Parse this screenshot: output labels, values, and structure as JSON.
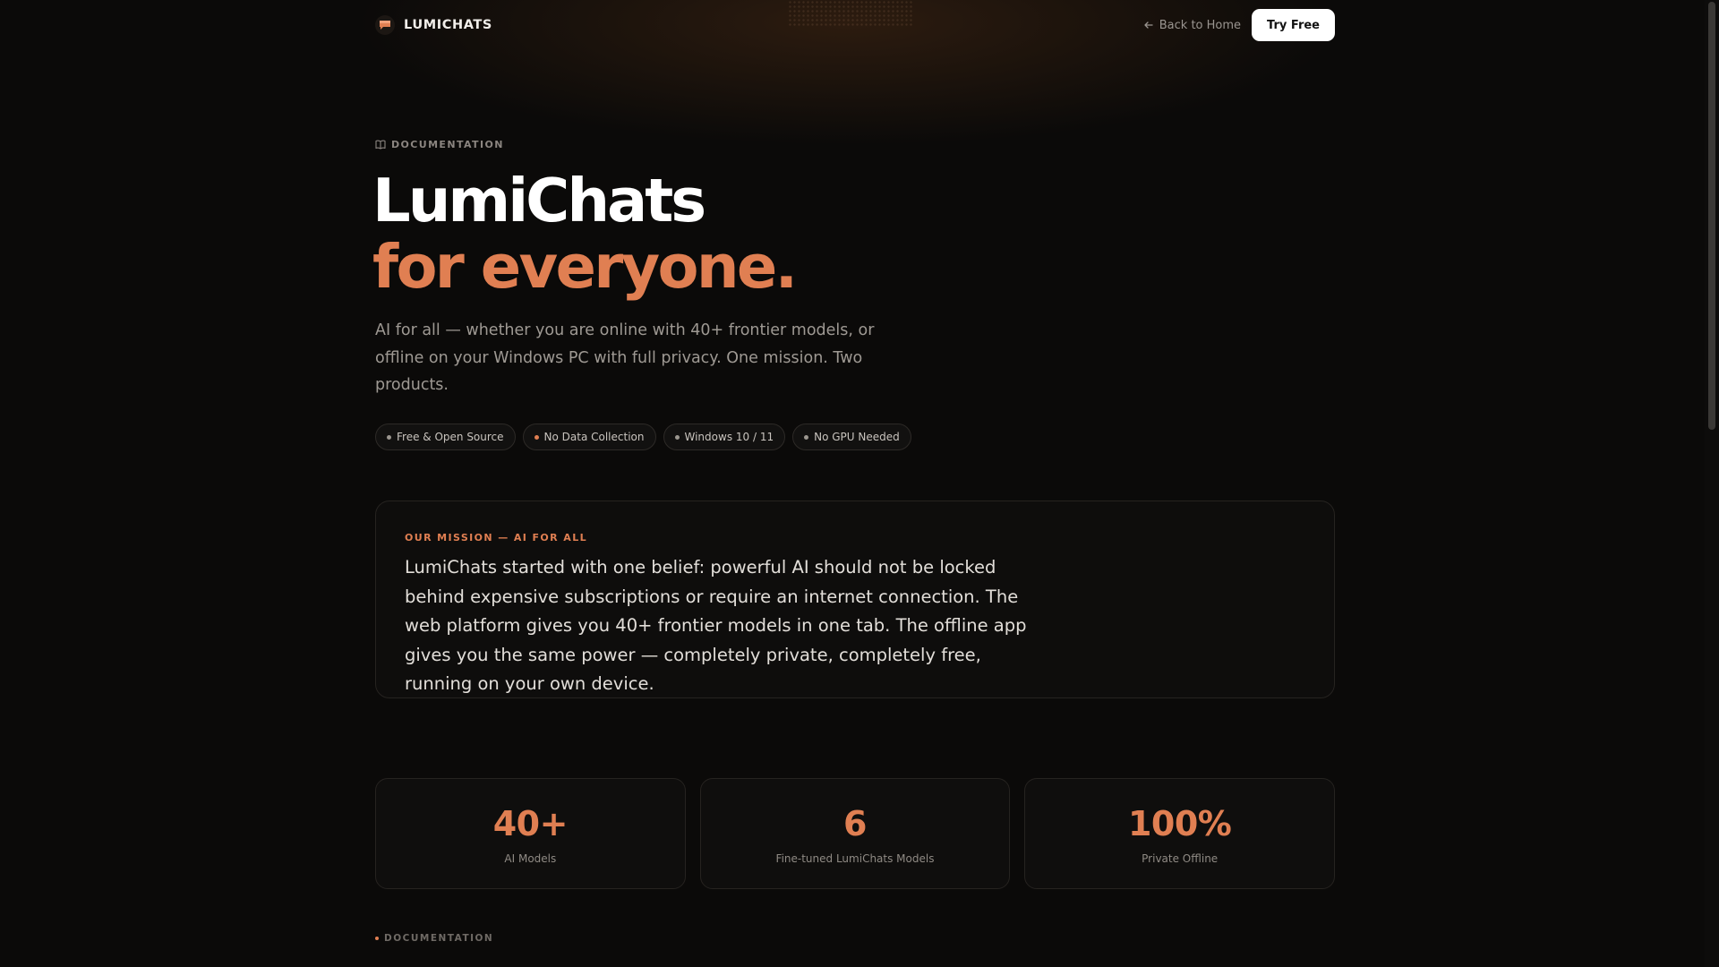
{
  "header": {
    "brand": "LUMICHATS",
    "logo_icon": "chat-bubble-icon",
    "back_label": "Back to Home",
    "cta_label": "Try Free"
  },
  "hero": {
    "eyebrow": "DOCUMENTATION",
    "title_line1": "LumiChats",
    "title_line2": "for everyone.",
    "lede": "AI for all — whether you are online with 40+ frontier models, or offline on your Windows PC with full privacy. One mission. Two products.",
    "pills": [
      {
        "label": "Free & Open Source",
        "dot": "#9b968f"
      },
      {
        "label": "No Data Collection",
        "dot": "#e07f52"
      },
      {
        "label": "Windows 10 / 11",
        "dot": "#9b968f"
      },
      {
        "label": "No GPU Needed",
        "dot": "#9b968f"
      }
    ]
  },
  "mission": {
    "label": "OUR MISSION — AI FOR ALL",
    "text": "LumiChats started with one belief: powerful AI should not be locked behind expensive subscriptions or require an internet connection. The web platform gives you 40+ frontier models in one tab. The offline app gives you the same power — completely private, completely free, running on your own device."
  },
  "stats": [
    {
      "value": "40+",
      "label": "AI Models"
    },
    {
      "value": "6",
      "label": "Fine-tuned LumiChats Models"
    },
    {
      "value": "100%",
      "label": "Private Offline"
    }
  ],
  "section": {
    "eyebrow": "DOCUMENTATION"
  },
  "colors": {
    "accent": "#e07f52",
    "background": "#0b0a09"
  }
}
